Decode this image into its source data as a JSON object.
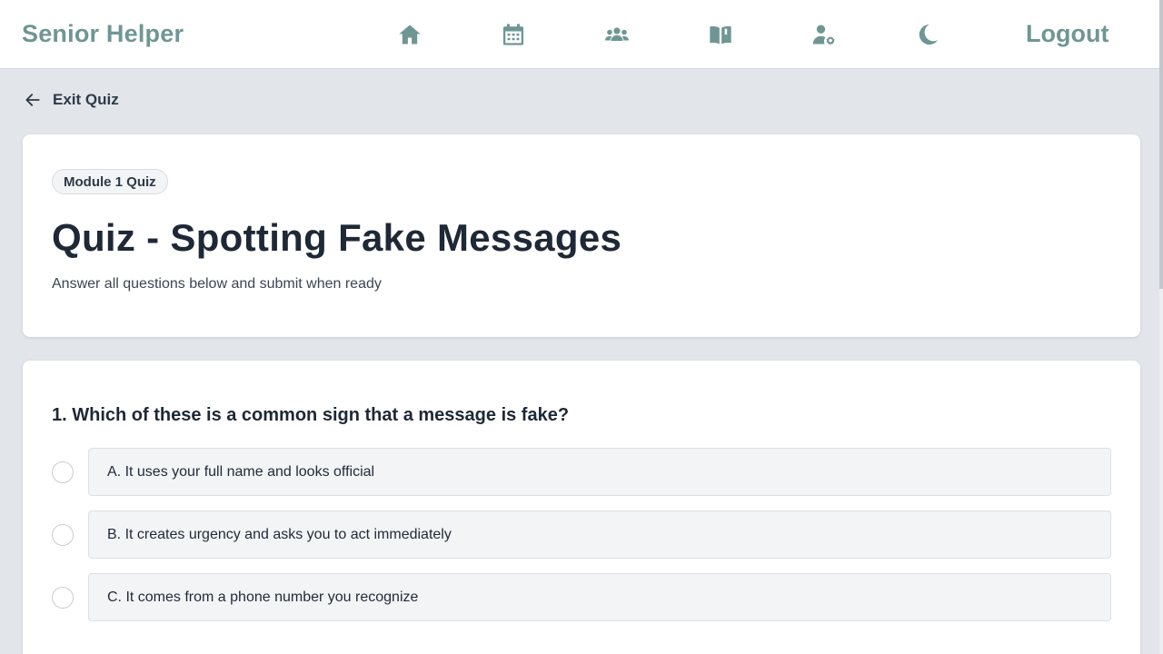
{
  "app": {
    "brand": "Senior Helper",
    "logout_label": "Logout",
    "nav_icons": [
      "home-icon",
      "calendar-icon",
      "users-icon",
      "book-icon",
      "user-settings-icon",
      "moon-icon"
    ],
    "accent_color": "#6f9694"
  },
  "back": {
    "label": "Exit Quiz",
    "icon": "arrow-left-icon"
  },
  "quiz": {
    "badge": "Module 1 Quiz",
    "title": "Quiz - Spotting Fake Messages",
    "subtitle": "Answer all questions below and submit when ready"
  },
  "question": {
    "text": "1. Which of these is a common sign that a message is fake?",
    "options": [
      {
        "label": "A. It uses your full name and looks official",
        "selected": false
      },
      {
        "label": "B. It creates urgency and asks you to act immediately",
        "selected": false
      },
      {
        "label": "C. It comes from a phone number you recognize",
        "selected": false
      }
    ]
  }
}
